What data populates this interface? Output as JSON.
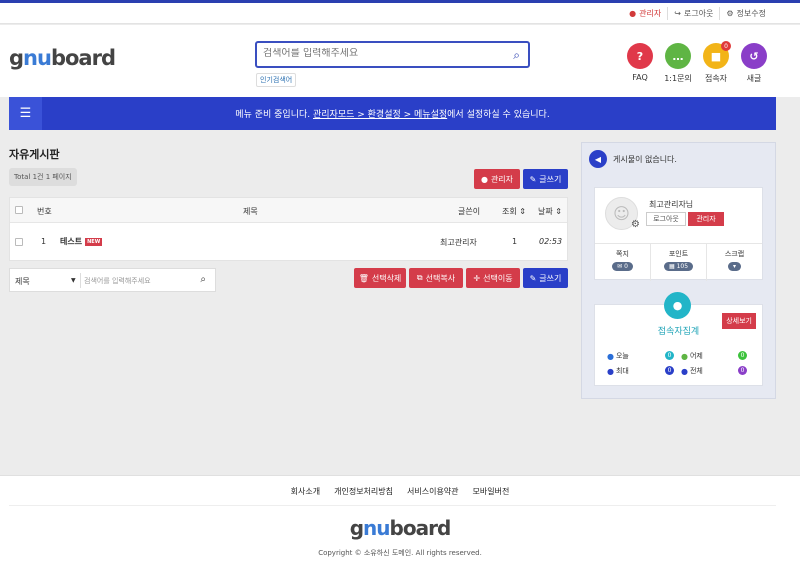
{
  "topbar": {
    "admin": "관리자",
    "logout": "로그아웃",
    "edit_info": "정보수정"
  },
  "header": {
    "logo_gnu_g": "g",
    "logo_nu": "nu",
    "logo_board": "board",
    "search_placeholder": "검색어를 입력해주세요",
    "popular": "인기검색어",
    "icons": [
      {
        "label": "FAQ",
        "glyph": "?",
        "color": "#e0384a"
      },
      {
        "label": "1:1문의",
        "glyph": "…",
        "color": "#5fb544"
      },
      {
        "label": "접속자",
        "glyph": "■",
        "color": "#f2b418",
        "badge": "0"
      },
      {
        "label": "새글",
        "glyph": "↺",
        "color": "#8a3ec8"
      }
    ]
  },
  "nav": {
    "msg_before": "메뉴 준비 중입니다. ",
    "msg_link": "관리자모드 > 환경설정 > 메뉴설정",
    "msg_after": "에서 설정하실 수 있습니다."
  },
  "board": {
    "title": "자유게시판",
    "total": "Total 1건 1 페이지",
    "admin_btn": "관리자",
    "write_btn": "글쓰기",
    "columns": {
      "num": "번호",
      "subject": "제목",
      "author": "글쓴이",
      "views": "조회",
      "date": "날짜"
    },
    "rows": [
      {
        "num": "1",
        "subject": "테스트",
        "new": "NEW",
        "author": "최고관리자",
        "views": "1",
        "date": "02:53"
      }
    ],
    "search_select": "제목",
    "search_placeholder": "검색어를 입력해주세요",
    "btn_delete": "선택삭제",
    "btn_copy": "선택복사",
    "btn_move": "선택이동",
    "btn_write2": "글쓰기"
  },
  "sidebar": {
    "notice": "게시물이 없습니다.",
    "profile_name": "최고관리자님",
    "logout": "로그아웃",
    "admin": "관리자",
    "stats": [
      {
        "label": "쪽지",
        "value": "0",
        "icon": "✉"
      },
      {
        "label": "포인트",
        "value": "105",
        "icon": "▦"
      },
      {
        "label": "스크랩",
        "value": "",
        "icon": "▾"
      }
    ],
    "visit_title": "접속자집계",
    "visit_detail": "상세보기",
    "visit_today": "오늘",
    "visit_today_v": "0",
    "visit_yesterday": "어제",
    "visit_yesterday_v": "0",
    "visit_max": "최대",
    "visit_max_v": "0",
    "visit_total": "전체",
    "visit_total_v": "0"
  },
  "footer": {
    "links": [
      "회사소개",
      "개인정보처리방침",
      "서비스이용약관",
      "모바일버전"
    ],
    "copyright": "Copyright © 소유하신 도메인. All rights reserved."
  }
}
